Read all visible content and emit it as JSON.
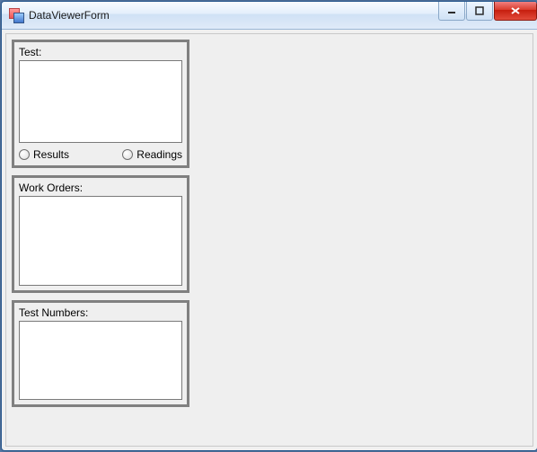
{
  "window": {
    "title": "DataViewerForm"
  },
  "winButtons": {
    "minimize": "minimize",
    "maximize": "maximize",
    "close": "close"
  },
  "panel": {
    "test": {
      "label": "Test:",
      "results_label": "Results",
      "readings_label": "Readings"
    },
    "work": {
      "label": "Work Orders:"
    },
    "nums": {
      "label": "Test Numbers:"
    }
  }
}
